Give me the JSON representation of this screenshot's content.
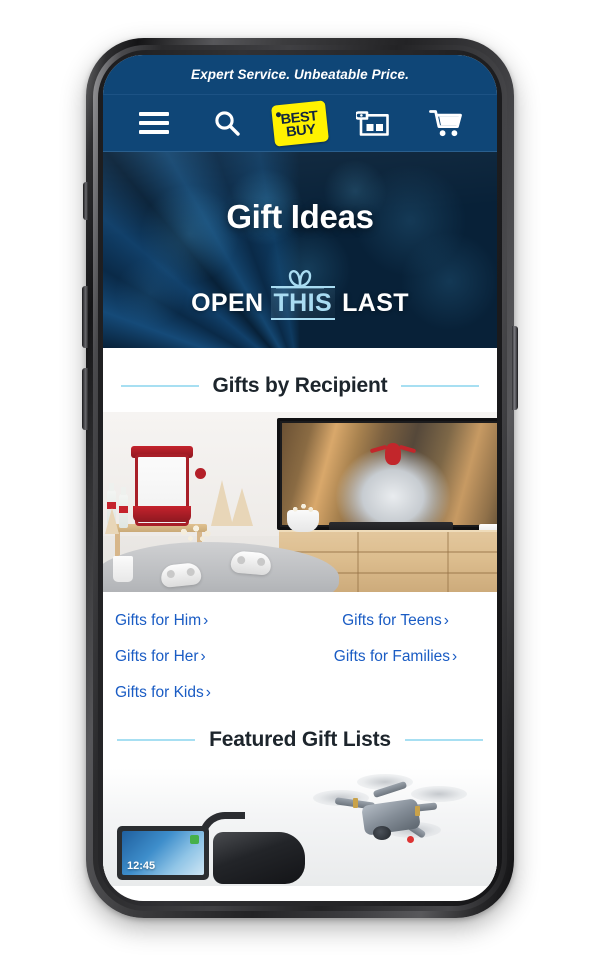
{
  "page": {
    "brand": "Best Buy",
    "device": "smartphone-mockup"
  },
  "header": {
    "tagline": "Expert Service. Unbeatable Price.",
    "nav": [
      {
        "name": "menu",
        "icon": "hamburger-menu-icon",
        "label": "Menu"
      },
      {
        "name": "search",
        "icon": "search-icon",
        "label": "Search"
      },
      {
        "name": "logo",
        "icon": "bestbuy-logo-tag",
        "label": "BEST BUY"
      },
      {
        "name": "store",
        "icon": "store-icon",
        "label": "Store"
      },
      {
        "name": "cart",
        "icon": "shopping-cart-icon",
        "label": "Cart"
      }
    ],
    "logo": {
      "line1": "BEST",
      "line2": "BUY",
      "tm": "™"
    }
  },
  "hero": {
    "title": "Gift Ideas",
    "lockup": {
      "word1": "OPEN",
      "word2": "THIS",
      "word3": "LAST",
      "bow_icon": "gift-bow-icon"
    },
    "colors": {
      "background_dark": "#0a2b4a",
      "background_accent": "#17507f",
      "accent_light_blue": "#a9dcf2"
    }
  },
  "sections": [
    {
      "id": "gifts-by-recipient",
      "title": "Gifts by Recipient",
      "image_alt": "Living room with wall-mounted TV showing superhero movie, soundbar, popcorn machine and game controllers",
      "links": [
        {
          "label": "Gifts for Him",
          "chevron": "›",
          "column": "left"
        },
        {
          "label": "Gifts for Teens",
          "chevron": "›",
          "column": "right"
        },
        {
          "label": "Gifts for Her",
          "chevron": "›",
          "column": "left"
        },
        {
          "label": "Gifts for Families",
          "chevron": "›",
          "column": "right"
        },
        {
          "label": "Gifts for Kids",
          "chevron": "›",
          "column": "left"
        }
      ]
    },
    {
      "id": "featured-gift-lists",
      "title": "Featured Gift Lists",
      "image_alt": "Tablet, VR headset and quadcopter drone",
      "tablet_time": "12:45"
    }
  ],
  "theme": {
    "header_blue": "#0f4677",
    "link_blue": "#1a5cc4",
    "rule_blue": "#a7dff2",
    "logo_yellow": "#fff200",
    "logo_navy": "#12263f",
    "title_dark": "#1d252c"
  }
}
